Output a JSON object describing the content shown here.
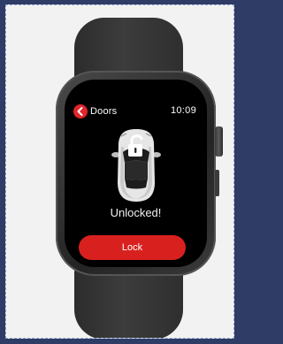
{
  "screen": {
    "back_label": "Doors",
    "time": "10:09",
    "status": "Unlocked!",
    "action_label": "Lock"
  },
  "colors": {
    "accent": "#d8211f",
    "screen_background": "#000000",
    "page_background": "#2e3c66"
  },
  "icons": {
    "back": "chevron-left-icon",
    "car": "car-top-view-icon",
    "padlock": "open-padlock-icon"
  }
}
